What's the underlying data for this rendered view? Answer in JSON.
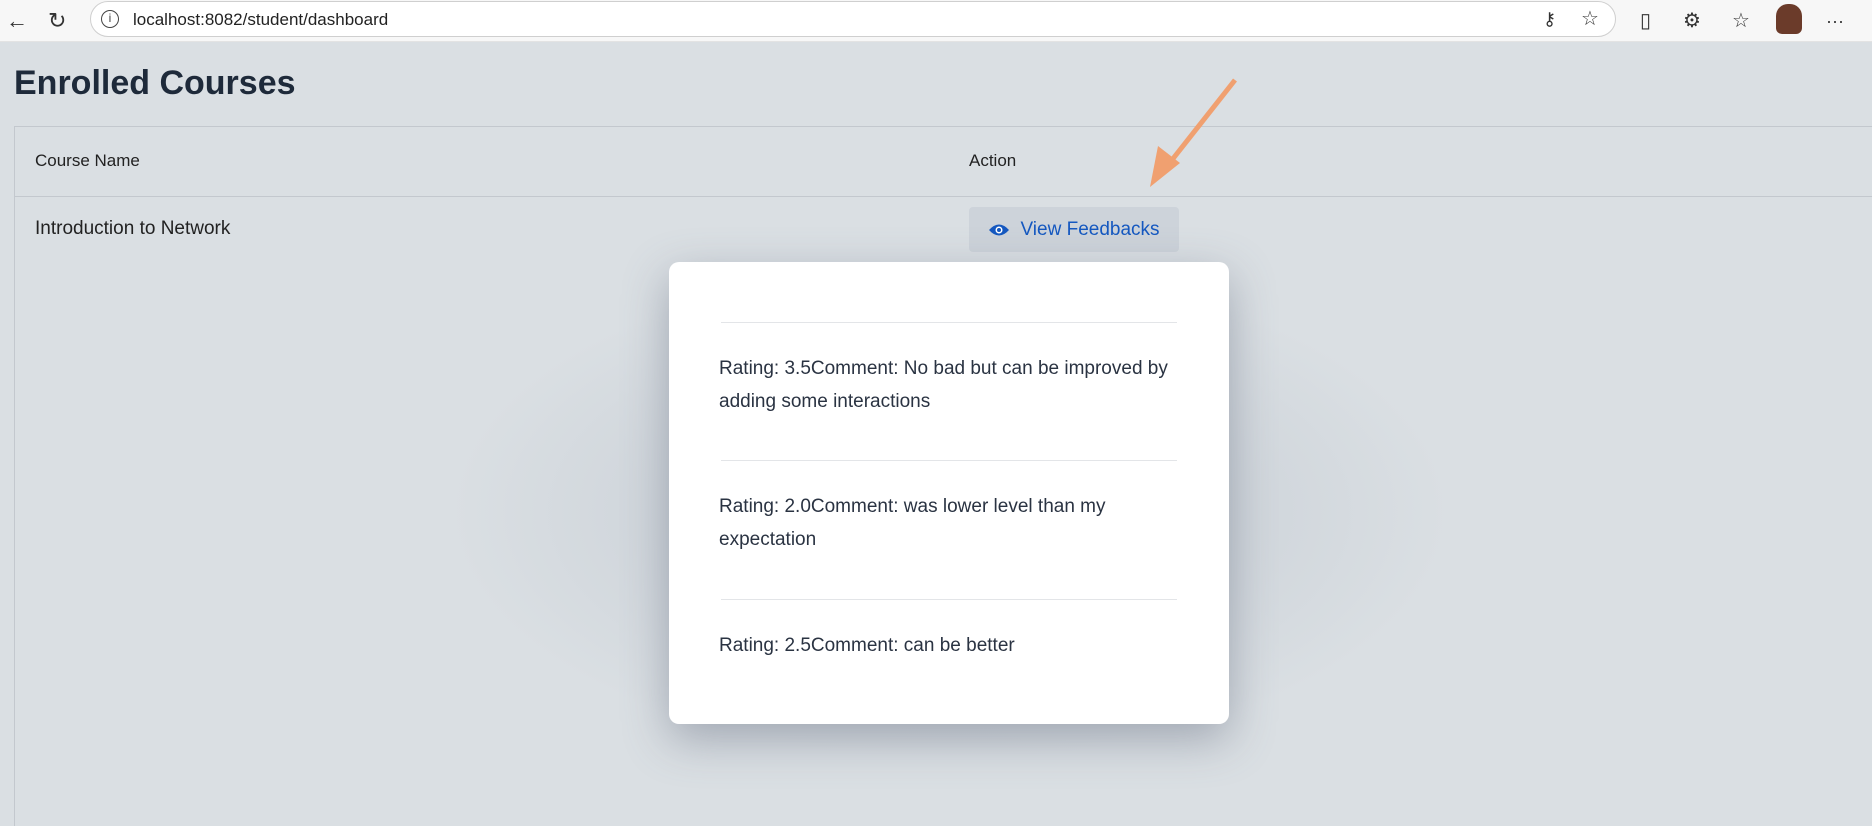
{
  "browser": {
    "url": "localhost:8082/student/dashboard"
  },
  "page": {
    "title": "Enrolled Courses"
  },
  "table": {
    "headers": [
      "Course Name",
      "Action"
    ],
    "rows": [
      {
        "course": "Introduction to Network",
        "action": "View Feedbacks"
      }
    ]
  },
  "modal": {
    "feedbacks": [
      "Rating: 3.5Comment: No bad but can be improved by adding some interactions",
      "Rating: 2.0Comment: was lower level than my expectation",
      "Rating: 2.5Comment: can be better"
    ]
  },
  "colors": {
    "accent": "#1558c0",
    "annotation_arrow": "#f0a070"
  }
}
